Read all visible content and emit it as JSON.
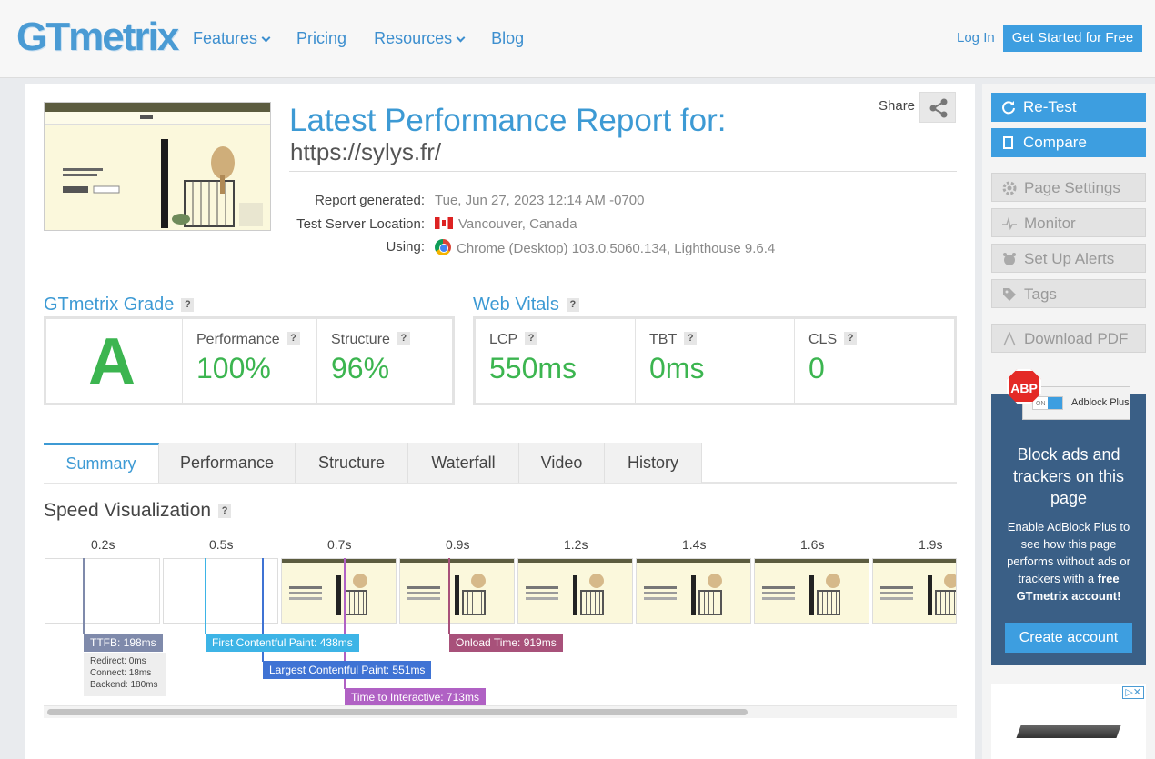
{
  "header": {
    "logo": "GTmetrix",
    "nav": [
      "Features",
      "Pricing",
      "Resources",
      "Blog"
    ],
    "login": "Log In",
    "cta": "Get Started for Free"
  },
  "report": {
    "title": "Latest Performance Report for:",
    "url": "https://sylys.fr/",
    "share_label": "Share",
    "generated_label": "Report generated:",
    "generated_value": "Tue, Jun 27, 2023 12:14 AM -0700",
    "location_label": "Test Server Location:",
    "location_value": "Vancouver, Canada",
    "using_label": "Using:",
    "using_value": "Chrome (Desktop) 103.0.5060.134, Lighthouse 9.6.4"
  },
  "grade": {
    "heading": "GTmetrix Grade",
    "letter": "A",
    "performance_label": "Performance",
    "performance_value": "100%",
    "structure_label": "Structure",
    "structure_value": "96%"
  },
  "vitals": {
    "heading": "Web Vitals",
    "lcp_label": "LCP",
    "lcp_value": "550ms",
    "tbt_label": "TBT",
    "tbt_value": "0ms",
    "cls_label": "CLS",
    "cls_value": "0"
  },
  "help_mark": "?",
  "tabs": [
    "Summary",
    "Performance",
    "Structure",
    "Waterfall",
    "Video",
    "History"
  ],
  "speed": {
    "title": "Speed Visualization",
    "times": [
      "0.2s",
      "0.5s",
      "0.7s",
      "0.9s",
      "1.2s",
      "1.4s",
      "1.6s",
      "1.9s"
    ],
    "ttfb": "TTFB: 198ms",
    "ttfb_redirect": "Redirect: 0ms",
    "ttfb_connect": "Connect: 18ms",
    "ttfb_backend": "Backend: 180ms",
    "fcp": "First Contentful Paint: 438ms",
    "lcp": "Largest Contentful Paint: 551ms",
    "tti": "Time to Interactive: 713ms",
    "onload": "Onload Time: 919ms",
    "colors": {
      "ttfb": "#7f8aab",
      "fcp": "#3db4e6",
      "lcp": "#3f73d4",
      "tti": "#b061c4",
      "onload": "#a8517a"
    }
  },
  "sidebar": {
    "retest": "Re-Test",
    "compare": "Compare",
    "page_settings": "Page Settings",
    "monitor": "Monitor",
    "alerts": "Set Up Alerts",
    "tags": "Tags",
    "pdf": "Download PDF"
  },
  "ad": {
    "badge": "ABP",
    "toggle": "ON",
    "brand": "Adblock Plus",
    "headline": "Block ads and trackers on this page",
    "body_prefix": "Enable AdBlock Plus to see how this page performs without ads or trackers with a",
    "body_bold": "free GTmetrix account!",
    "button": "Create account"
  }
}
